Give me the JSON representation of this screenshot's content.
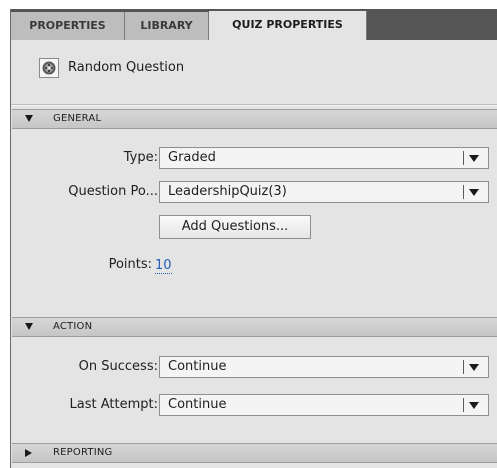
{
  "tabs": [
    {
      "label": "PROPERTIES",
      "active": false
    },
    {
      "label": "LIBRARY",
      "active": false
    },
    {
      "label": "QUIZ PROPERTIES",
      "active": true
    }
  ],
  "header": {
    "icon": "random-question-icon",
    "title": "Random Question"
  },
  "sections": {
    "general": {
      "label": "GENERAL",
      "expanded": true,
      "type_label": "Type:",
      "type_value": "Graded",
      "pool_label": "Question Po...",
      "pool_value": "LeadershipQuiz(3)",
      "add_questions_label": "Add Questions...",
      "points_label": "Points:",
      "points_value": "10"
    },
    "action": {
      "label": "ACTION",
      "expanded": true,
      "on_success_label": "On Success:",
      "on_success_value": "Continue",
      "last_attempt_label": "Last Attempt:",
      "last_attempt_value": "Continue"
    },
    "reporting": {
      "label": "REPORTING",
      "expanded": false
    }
  },
  "colors": {
    "panel_bg": "#e4e4e4",
    "tabstrip_bg": "#555555",
    "link": "#1f5fb4"
  }
}
